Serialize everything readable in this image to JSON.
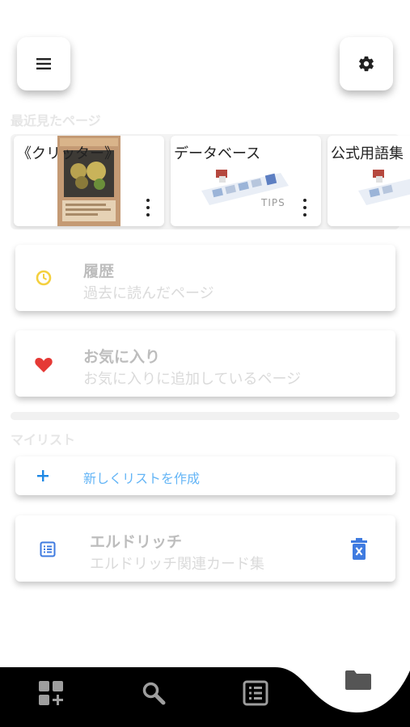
{
  "header": {
    "menu_icon": "hamburger-menu-icon",
    "settings_icon": "gear-icon"
  },
  "recent": {
    "section_title": "最近見たページ",
    "cards": [
      {
        "title": "《クリッター》",
        "thumbnail": "monster-card-image"
      },
      {
        "title": "データベース",
        "thumbnail": "cards-illustration",
        "badge": "TIPS"
      },
      {
        "title": "公式用語集",
        "thumbnail": "cards-illustration"
      }
    ]
  },
  "history": {
    "title": "履歴",
    "subtitle": "過去に読んだページ",
    "icon": "clock-icon",
    "icon_color": "#f4d03f"
  },
  "favorites": {
    "title": "お気に入り",
    "subtitle": "お気に入りに追加しているページ",
    "icon": "heart-icon",
    "icon_color": "#e53935"
  },
  "mylist": {
    "section_title": "マイリスト",
    "create_label": "新しくリストを作成",
    "create_color": "#64b5f6",
    "items": [
      {
        "title": "エルドリッチ",
        "subtitle": "エルドリッチ関連カード集",
        "icon": "list-icon",
        "delete_icon": "trash-icon"
      }
    ]
  },
  "bottom_nav": {
    "items": [
      {
        "icon": "add-grid-icon",
        "active": false
      },
      {
        "icon": "search-icon",
        "active": false
      },
      {
        "icon": "list-box-icon",
        "active": false
      },
      {
        "icon": "folder-icon",
        "active": true
      }
    ]
  }
}
